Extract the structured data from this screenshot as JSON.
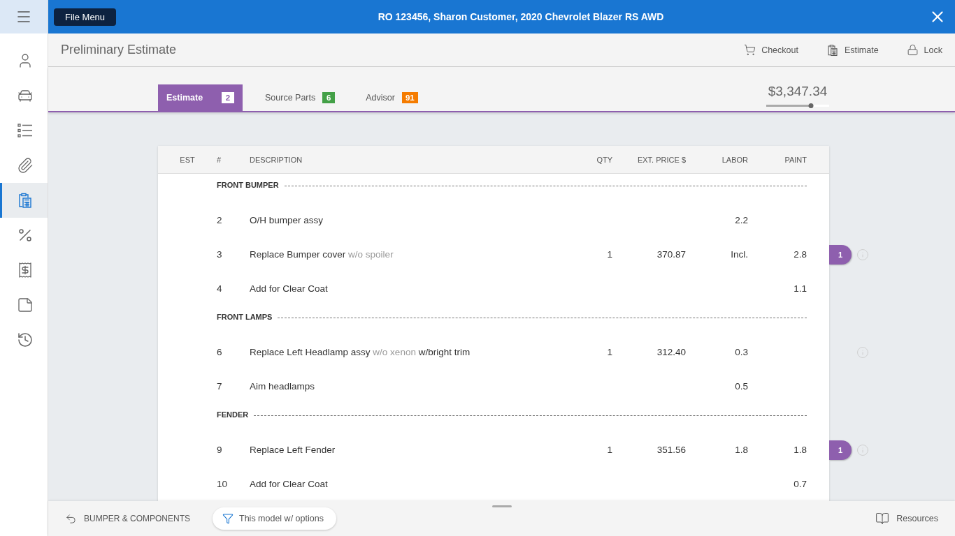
{
  "header": {
    "file_menu": "File Menu",
    "title": "RO 123456, Sharon Customer, 2020 Chevrolet Blazer RS AWD"
  },
  "sidebar": {
    "items": [
      {
        "selected": false
      },
      {
        "selected": false
      },
      {
        "selected": false
      },
      {
        "selected": false
      },
      {
        "selected": true
      },
      {
        "selected": false
      },
      {
        "selected": false
      },
      {
        "selected": false
      },
      {
        "selected": false
      }
    ]
  },
  "page": {
    "title": "Preliminary Estimate",
    "actions": [
      "Checkout",
      "Estimate",
      "Lock"
    ]
  },
  "tabs": [
    {
      "label": "Estimate",
      "count": "2",
      "color": "#8e5fae",
      "selected": true
    },
    {
      "label": "Source Parts",
      "count": "6",
      "color": "#43a047",
      "selected": false
    },
    {
      "label": "Advisor",
      "count": "91",
      "color": "#f57c00",
      "selected": false
    }
  ],
  "total": {
    "amount": "$3,347.34",
    "level": 0.71
  },
  "table": {
    "columns": [
      "EST",
      "#",
      "DESCRIPTION",
      "QTY",
      "EXT. PRICE $",
      "LABOR",
      "PAINT"
    ],
    "rows": [
      {
        "kind": "section",
        "label": "FRONT BUMPER"
      },
      {
        "kind": "item",
        "number": "2",
        "description": [
          {
            "text": "O/H bumper assy",
            "muted": false
          }
        ],
        "labor": "2.2",
        "info": false
      },
      {
        "kind": "item",
        "number": "3",
        "description": [
          {
            "text": "Replace Bumper cover",
            "muted": false
          },
          {
            "text": "w/o spoiler",
            "muted": true
          }
        ],
        "qty": "1",
        "ext_price": "370.87",
        "labor": "Incl.",
        "paint": "2.8",
        "badge": "1",
        "info": true
      },
      {
        "kind": "item",
        "number": "4",
        "description": [
          {
            "text": "Add for Clear Coat",
            "muted": false
          }
        ],
        "paint": "1.1",
        "info": false
      },
      {
        "kind": "section",
        "label": "FRONT LAMPS"
      },
      {
        "kind": "item",
        "number": "6",
        "description": [
          {
            "text": "Replace Left Headlamp assy",
            "muted": false
          },
          {
            "text": "w/o xenon",
            "muted": true
          },
          {
            "text": "w/bright trim",
            "muted": false
          }
        ],
        "qty": "1",
        "ext_price": "312.40",
        "labor": "0.3",
        "info": true
      },
      {
        "kind": "item",
        "number": "7",
        "description": [
          {
            "text": "Aim headlamps",
            "muted": false
          }
        ],
        "labor": "0.5",
        "info": false
      },
      {
        "kind": "section",
        "label": "FENDER"
      },
      {
        "kind": "item",
        "number": "9",
        "description": [
          {
            "text": "Replace Left Fender",
            "muted": false
          }
        ],
        "qty": "1",
        "ext_price": "351.56",
        "labor": "1.8",
        "paint": "1.8",
        "badge": "1",
        "info": true
      },
      {
        "kind": "item",
        "number": "10",
        "description": [
          {
            "text": "Add for Clear Coat",
            "muted": false
          }
        ],
        "paint": "0.7",
        "info": false
      }
    ]
  },
  "footer": {
    "back": "BUMPER & COMPONENTS",
    "filter": "This model w/ options",
    "resources": "Resources"
  }
}
